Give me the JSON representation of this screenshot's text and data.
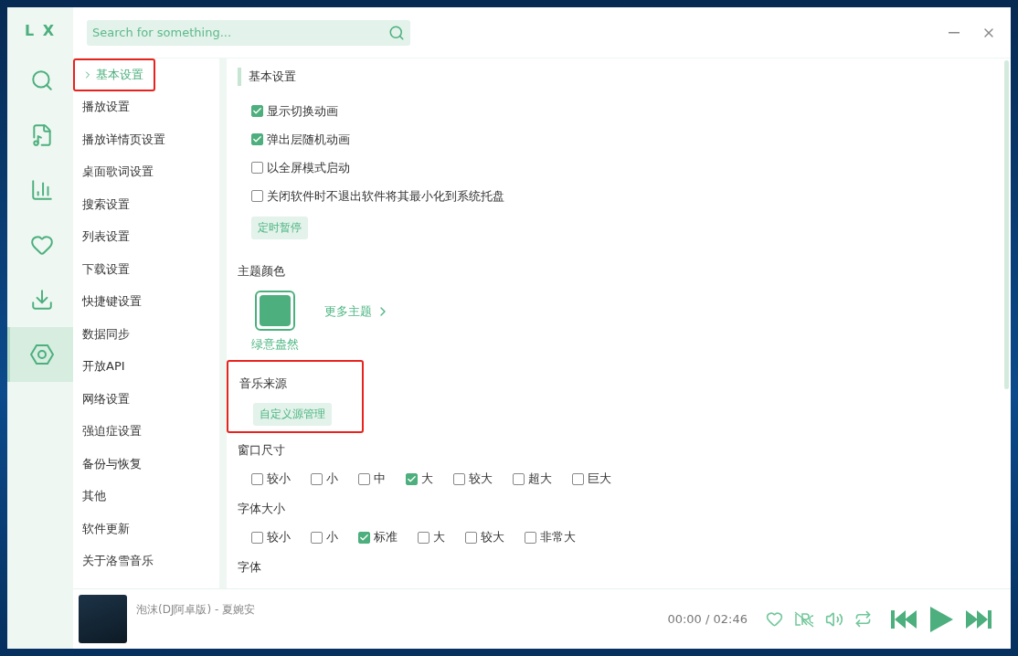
{
  "sidebar": {
    "logo": "L X",
    "items": [
      {
        "kind": "search",
        "selected": false
      },
      {
        "kind": "music",
        "selected": false
      },
      {
        "kind": "chart",
        "selected": false
      },
      {
        "kind": "heart",
        "selected": false
      },
      {
        "kind": "download",
        "selected": false
      },
      {
        "kind": "settings",
        "selected": true
      }
    ]
  },
  "search": {
    "placeholder": "Search for something..."
  },
  "nav": {
    "items": [
      {
        "label": "基本设置",
        "selected": true,
        "highlighted": true
      },
      {
        "label": "播放设置",
        "selected": false,
        "highlighted": false
      },
      {
        "label": "播放详情页设置",
        "selected": false,
        "highlighted": false
      },
      {
        "label": "桌面歌词设置",
        "selected": false,
        "highlighted": false
      },
      {
        "label": "搜索设置",
        "selected": false,
        "highlighted": false
      },
      {
        "label": "列表设置",
        "selected": false,
        "highlighted": false
      },
      {
        "label": "下载设置",
        "selected": false,
        "highlighted": false
      },
      {
        "label": "快捷键设置",
        "selected": false,
        "highlighted": false
      },
      {
        "label": "数据同步",
        "selected": false,
        "highlighted": false
      },
      {
        "label": "开放API",
        "selected": false,
        "highlighted": false
      },
      {
        "label": "网络设置",
        "selected": false,
        "highlighted": false
      },
      {
        "label": "强迫症设置",
        "selected": false,
        "highlighted": false
      },
      {
        "label": "备份与恢复",
        "selected": false,
        "highlighted": false
      },
      {
        "label": "其他",
        "selected": false,
        "highlighted": false
      },
      {
        "label": "软件更新",
        "selected": false,
        "highlighted": false
      },
      {
        "label": "关于洛雪音乐",
        "selected": false,
        "highlighted": false
      }
    ]
  },
  "sections": [
    {
      "kind": "group",
      "title": "基本设置",
      "checks": [
        {
          "label": "显示切换动画",
          "checked": true
        },
        {
          "label": "弹出层随机动画",
          "checked": true
        },
        {
          "label": "以全屏模式启动",
          "checked": false
        },
        {
          "label": "关闭软件时不退出软件将其最小化到系统托盘",
          "checked": false
        }
      ],
      "button": "定时暂停"
    },
    {
      "kind": "theme",
      "title": "主题颜色",
      "themes": [
        {
          "name": "绿意盎然",
          "color": "#4caf7d",
          "selected": true
        }
      ],
      "more": "更多主题"
    },
    {
      "kind": "source",
      "title": "音乐来源",
      "button": "自定义源管理",
      "highlighted": true
    },
    {
      "kind": "inline",
      "title": "窗口尺寸",
      "options": [
        {
          "label": "较小",
          "checked": false
        },
        {
          "label": "小",
          "checked": false
        },
        {
          "label": "中",
          "checked": false
        },
        {
          "label": "大",
          "checked": true
        },
        {
          "label": "较大",
          "checked": false
        },
        {
          "label": "超大",
          "checked": false
        },
        {
          "label": "巨大",
          "checked": false
        }
      ]
    },
    {
      "kind": "inline",
      "title": "字体大小",
      "options": [
        {
          "label": "较小",
          "checked": false
        },
        {
          "label": "小",
          "checked": false
        },
        {
          "label": "标准",
          "checked": true
        },
        {
          "label": "大",
          "checked": false
        },
        {
          "label": "较大",
          "checked": false
        },
        {
          "label": "非常大",
          "checked": false
        }
      ]
    },
    {
      "kind": "inline",
      "title": "字体"
    }
  ],
  "player": {
    "title": "泡沫(DJ阿卓版) - 夏婉安",
    "time": "00:00 / 02:46"
  }
}
